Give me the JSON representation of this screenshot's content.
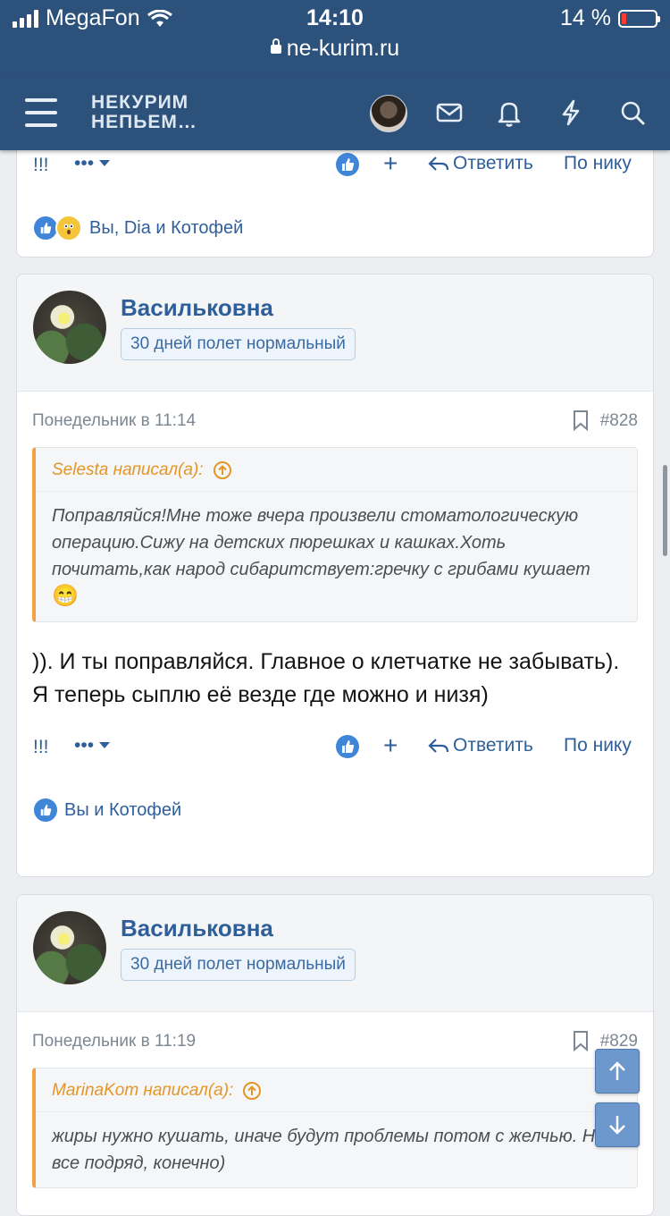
{
  "status_bar": {
    "carrier": "MegaFon",
    "time": "14:10",
    "battery": "14 %",
    "battery_level": 0.14,
    "url": "ne-kurim.ru"
  },
  "nav": {
    "logo_line1": "НЕКУРИМ",
    "logo_line2": "НЕПЬЕМ…",
    "icons": [
      "menu-icon",
      "user-avatar",
      "mail-icon",
      "bell-icon",
      "bolt-icon",
      "search-icon"
    ]
  },
  "top_post": {
    "mod_label": "!!!",
    "more_label": "•••",
    "plus_label": "+",
    "reply_label": "Ответить",
    "quote_nick_label": "По нику",
    "reactions_text": "Вы, Dia и Котофей"
  },
  "posts": [
    {
      "username": "Васильковна",
      "user_title": "30 дней полет нормальный",
      "date": "Понедельник в 11:14",
      "number": "#828",
      "quote_author": "Selesta написал(а):",
      "quote_text": "Поправляйся!Мне тоже вчера произвели стоматологическую операцию.Сижу на детских пюрешках и кашках.Хоть почитать,как народ сибаритствует:гречку с грибами кушает",
      "quote_emoji": "😁",
      "text": ")). И ты поправляйся. Главное о клетчатке не забывать). Я теперь сыплю её везде где можно и низя)",
      "mod_label": "!!!",
      "more_label": "•••",
      "plus_label": "+",
      "reply_label": "Ответить",
      "quote_nick_label": "По нику",
      "reactions_text": "Вы и Котофей"
    },
    {
      "username": "Васильковна",
      "user_title": "30 дней полет нормальный",
      "date": "Понедельник в 11:19",
      "number": "#829",
      "quote_author": "MarinaKom написал(а):",
      "quote_text": "жиры нужно кушать, иначе будут проблемы потом с желчью. Не все подряд, конечно)"
    }
  ],
  "colors": {
    "header_bg": "#2c527c",
    "link": "#2f5f9a",
    "quote_accent": "#f0a244",
    "like": "#3f86d8"
  }
}
